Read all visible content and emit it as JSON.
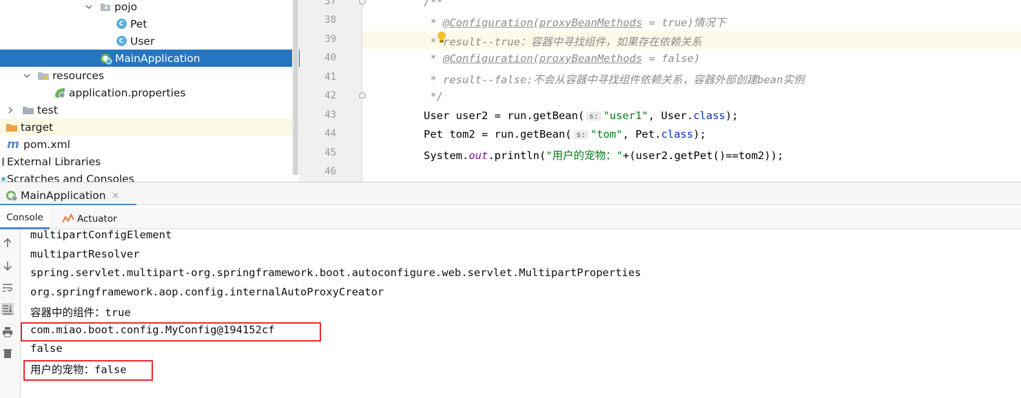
{
  "project_tree": {
    "items": [
      {
        "label": "pojo",
        "icon": "package-icon"
      },
      {
        "label": "Pet",
        "icon": "class-icon"
      },
      {
        "label": "User",
        "icon": "class-icon"
      },
      {
        "label": "MainApplication",
        "icon": "spring-boot-class-icon"
      },
      {
        "label": "resources",
        "icon": "resources-folder-icon"
      },
      {
        "label": "application.properties",
        "icon": "spring-properties-icon"
      },
      {
        "label": "test",
        "icon": "folder-icon"
      },
      {
        "label": "target",
        "icon": "excluded-folder-icon"
      },
      {
        "label": "pom.xml",
        "icon": "maven-icon"
      },
      {
        "label": "External Libraries",
        "icon": "libraries-icon"
      },
      {
        "label": "Scratches and Consoles",
        "icon": "scratches-icon"
      }
    ],
    "class_badge": "C"
  },
  "editor": {
    "line_numbers": [
      "37",
      "38",
      "39",
      "40",
      "41",
      "42",
      "43",
      "44",
      "45",
      "46"
    ],
    "lines": {
      "l37": "/**",
      "l38_star": " * ",
      "l38_anno": "@Configuration(proxyBeanMethods",
      "l38_rest": " = true)情况下",
      "l39": " * result--true：容器中寻找组件，如果存在依赖关系",
      "l40_star": " * ",
      "l40_anno": "@Configuration(proxyBeanMethods",
      "l40_rest": " = false)",
      "l41": " * result--false:不会从容器中寻找组件依赖关系，容器外部创建bean实例",
      "l42": " */",
      "l43_a": "User user2 = run.getBean(",
      "l43_str": "\"user1\"",
      "l43_b": ", User.",
      "l43_kw": "class",
      "l43_c": ");",
      "l44_a": "Pet tom2 = run.getBean(",
      "l44_str": "\"tom\"",
      "l44_b": ", Pet.",
      "l44_kw": "class",
      "l44_c": ");",
      "l45_a": "System.",
      "l45_fld": "out",
      "l45_b": ".println(",
      "l45_str": "\"用户的宠物：\"",
      "l45_c": "+(user2.getPet()==tom2));"
    },
    "param_hint": "s:"
  },
  "run_window": {
    "run_tab_label": "MainApplication",
    "close_glyph": "×",
    "subtabs": {
      "console": "Console",
      "actuator": "Actuator"
    },
    "console_lines": [
      "multipartConfigElement",
      "multipartResolver",
      "spring.servlet.multipart-org.springframework.boot.autoconfigure.web.servlet.MultipartProperties",
      "org.springframework.aop.config.internalAutoProxyCreator",
      "容器中的组件：true",
      "com.miao.boot.config.MyConfig@194152cf",
      "false",
      "用户的宠物：false"
    ]
  },
  "colors": {
    "selection": "#2675bf",
    "annotation_box": "#e8282b",
    "string": "#067d17",
    "keyword": "#0033b3"
  }
}
